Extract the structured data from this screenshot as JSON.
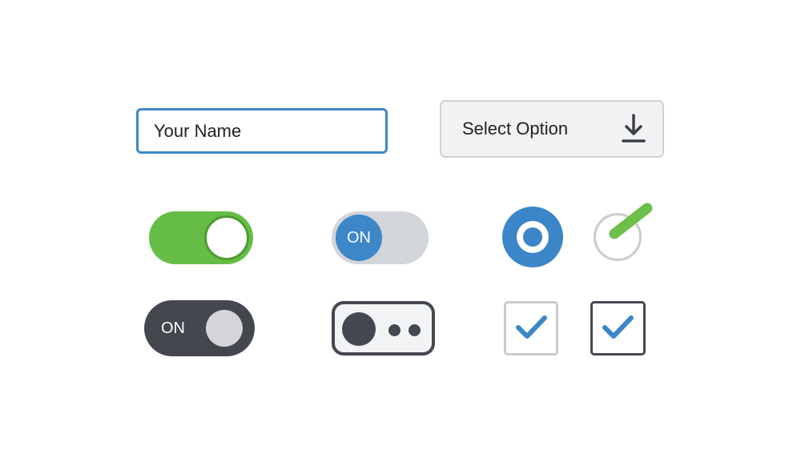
{
  "form": {
    "name_input": {
      "value": "Your Name"
    },
    "select": {
      "selected": "Select Option",
      "icon": "download-icon"
    }
  },
  "controls": {
    "green_toggle": {
      "state": "on",
      "color": "#65bd45"
    },
    "blue_toggle": {
      "label": "ON",
      "color": "#3d86c8"
    },
    "radio": {
      "state": "selected",
      "color": "#3b86c8"
    },
    "check_circle": {
      "icon": "checkmark-icon",
      "color": "#6cc04a"
    },
    "dark_toggle": {
      "label": "ON",
      "color": "#44474d"
    },
    "outline_switch": {
      "icon": "dots-icon"
    },
    "checkbox_light": {
      "state": "checked",
      "color": "#3d86c8"
    },
    "checkbox_dark": {
      "state": "checked",
      "color": "#3d86c8"
    }
  }
}
